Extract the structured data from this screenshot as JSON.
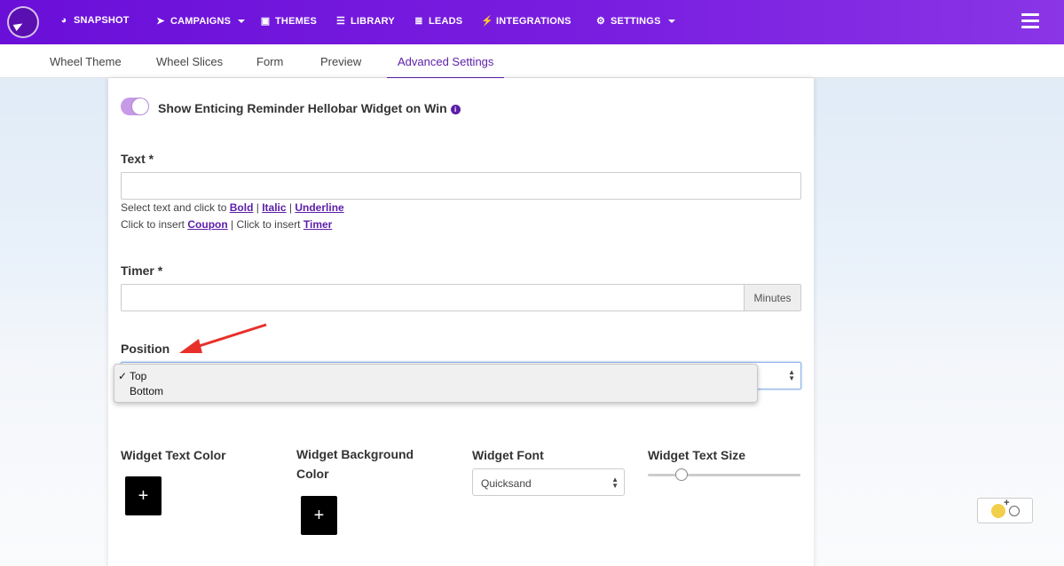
{
  "nav": {
    "items": [
      {
        "label": "SNAPSHOT",
        "icon": "dashboard-icon"
      },
      {
        "label": "CAMPAIGNS",
        "icon": "paper-plane-icon",
        "dropdown": true
      },
      {
        "label": "THEMES",
        "icon": "image-icon"
      },
      {
        "label": "LIBRARY",
        "icon": "library-icon"
      },
      {
        "label": "LEADS",
        "icon": "list-icon"
      },
      {
        "label": "INTEGRATIONS",
        "icon": "plug-icon"
      },
      {
        "label": "SETTINGS",
        "icon": "cogs-icon",
        "dropdown": true
      }
    ]
  },
  "subtabs": {
    "items": [
      "Wheel Theme",
      "Wheel Slices",
      "Form",
      "Preview",
      "Advanced Settings"
    ],
    "active": "Advanced Settings"
  },
  "form": {
    "toggle_label": "Show Enticing Reminder Hellobar Widget on Win",
    "text_label": "Text *",
    "text_value": "",
    "helper": {
      "line1_prefix": "Select text and click to",
      "bold": "Bold",
      "italic": "Italic",
      "underline": "Underline",
      "line2_prefix": "Click to insert",
      "coupon": "Coupon",
      "line2_middle": "Click to insert",
      "timer": "Timer"
    },
    "timer_label": "Timer *",
    "timer_value": "",
    "timer_addon": "Minutes",
    "position_label": "Position",
    "position_options": [
      "Top",
      "Bottom"
    ],
    "position_selected": "Top",
    "widget_text_color_label": "Widget Text Color",
    "widget_bg_color_label": "Widget Background Color",
    "widget_font_label": "Widget Font",
    "widget_font_value": "Quicksand",
    "widget_text_size_label": "Widget Text Size",
    "widget_text_size_fraction": 0.22,
    "add_symbol": "+"
  },
  "colors": {
    "nav_gradient_start": "#6a0fd8",
    "accent": "#5b1ea8",
    "toggle_on": "#c79ae8",
    "annotation_arrow": "#e8302a"
  }
}
